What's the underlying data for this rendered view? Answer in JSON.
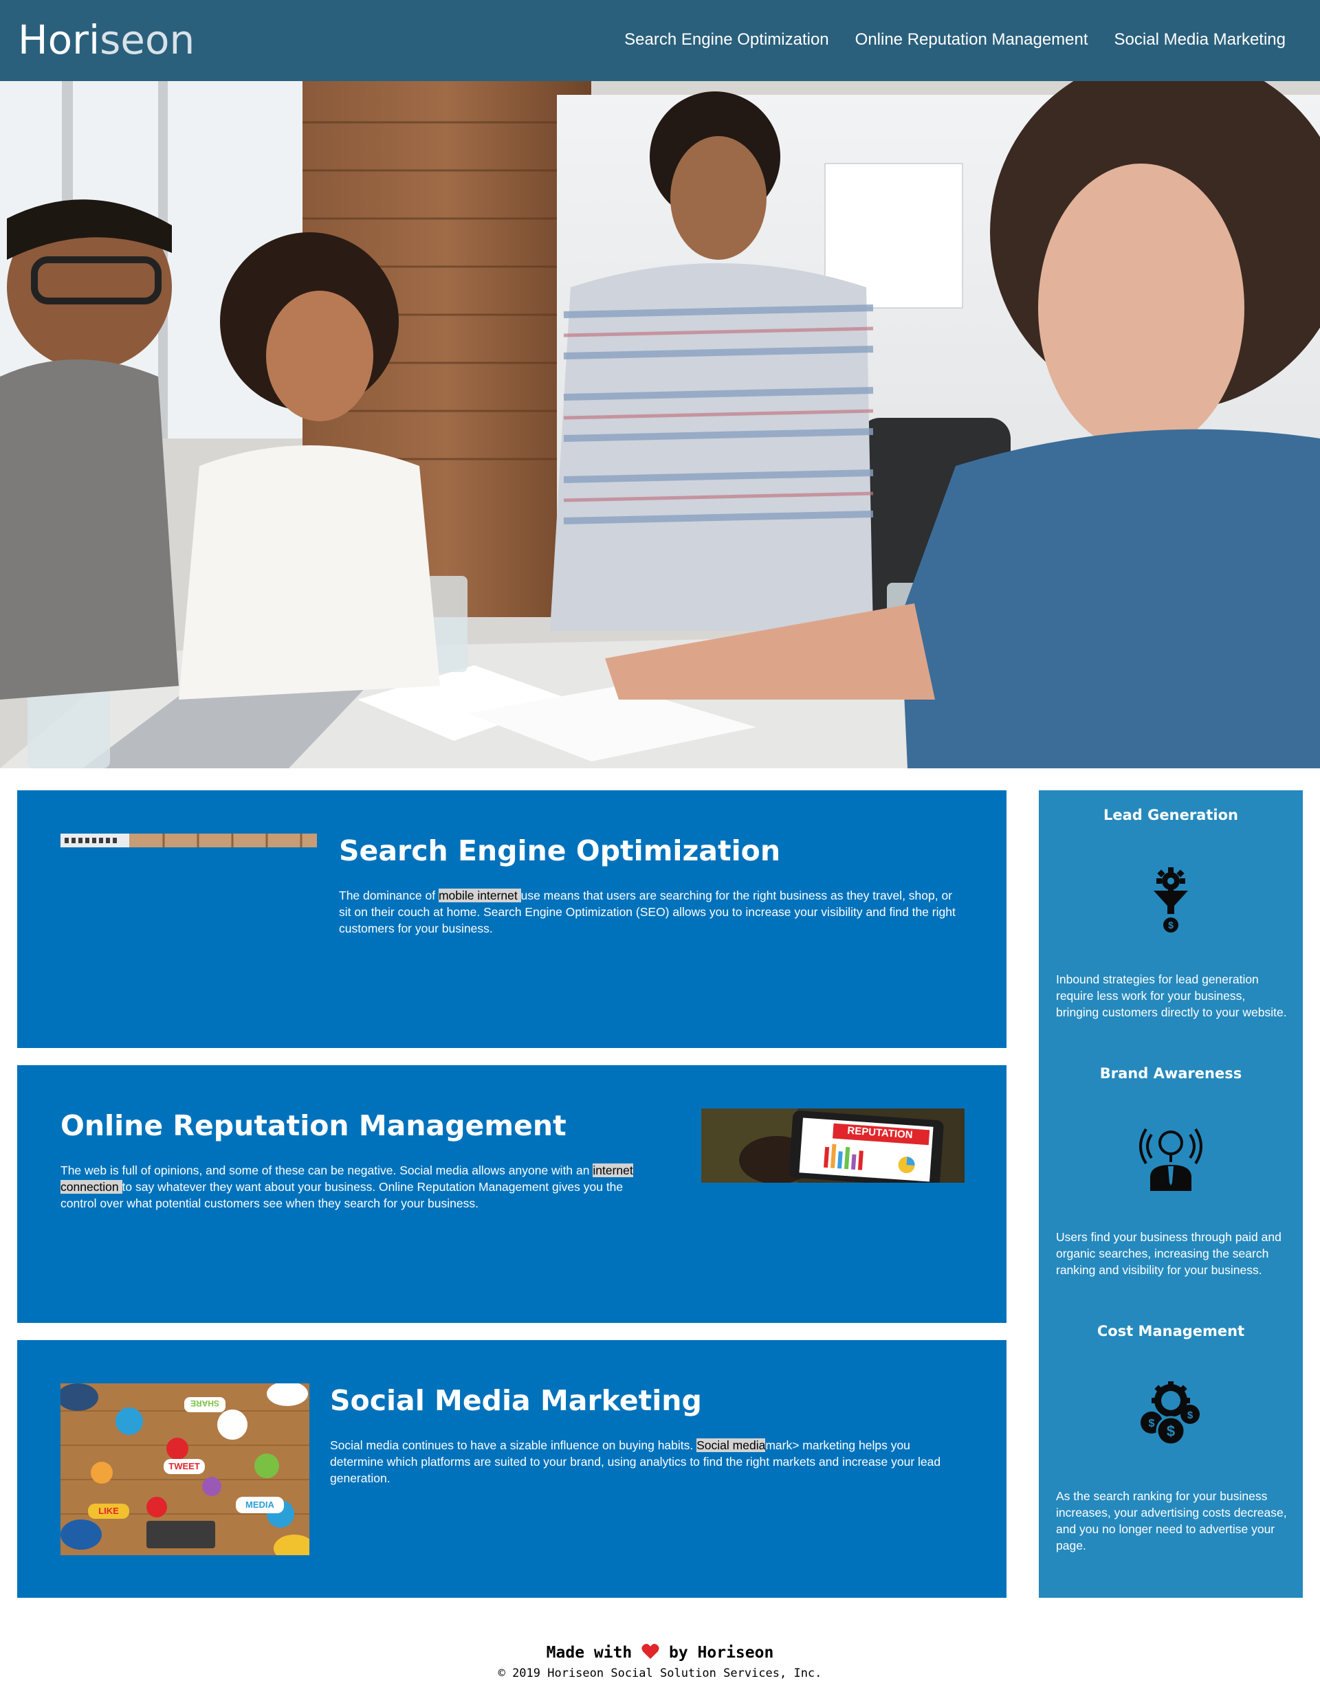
{
  "header": {
    "logo_main": "Hori",
    "logo_accent": "seon",
    "nav": [
      {
        "label": "Search Engine Optimization"
      },
      {
        "label": "Online Reputation Management"
      },
      {
        "label": "Social Media Marketing"
      }
    ]
  },
  "hero": {
    "image": "team-meeting-photo"
  },
  "sections": {
    "seo": {
      "title": "Search Engine Optimization",
      "text_before": "The dominance of ",
      "highlight": "mobile internet ",
      "text_after": "use means that users are searching for the right business as they travel, shop, or sit on their couch at home. Search Engine Optimization (SEO) allows you to increase your visibility and find the right customers for your business."
    },
    "orm": {
      "title": "Online Reputation Management",
      "text_before": "The web is full of opinions, and some of these can be negative. Social media allows anyone with an ",
      "highlight": "internet connection ",
      "text_after": "to say whatever they want about your business. Online Reputation Management gives you the control over what potential customers see when they search for your business.",
      "image_label": "REPUTATION"
    },
    "smm": {
      "title": "Social Media Marketing",
      "text_before": "Social media continues to have a sizable influence on buying habits. ",
      "highlight": "Social media",
      "text_after": "mark> marketing helps you determine which platforms are suited to your brand, using analytics to find the right markets and increase your lead generation.",
      "image_words": [
        "SHARE",
        "TWEET",
        "LIKE",
        "MEDIA"
      ]
    }
  },
  "sidebar": {
    "lead": {
      "title": "Lead Generation",
      "text": "Inbound strategies for lead generation require less work for your business, bringing customers directly to your website.",
      "icon": "funnel-gear-icon"
    },
    "brand": {
      "title": "Brand Awareness",
      "text": "Users find your business through paid and organic searches, increasing the search ranking and visibility for your business.",
      "icon": "lightbulb-person-icon"
    },
    "cost": {
      "title": "Cost Management",
      "text": "As the search ranking for your business increases, your advertising costs decrease, and you no longer need to advertise your page.",
      "icon": "coins-gear-icon"
    }
  },
  "footer": {
    "made_with": "Made with",
    "by": "by Horiseon",
    "copyright": "© 2019 Horiseon Social Solution Services, Inc."
  },
  "colors": {
    "header": "#2a607c",
    "card": "#0072bb",
    "sidebar": "#2589bd",
    "heart": "#e0262b"
  }
}
